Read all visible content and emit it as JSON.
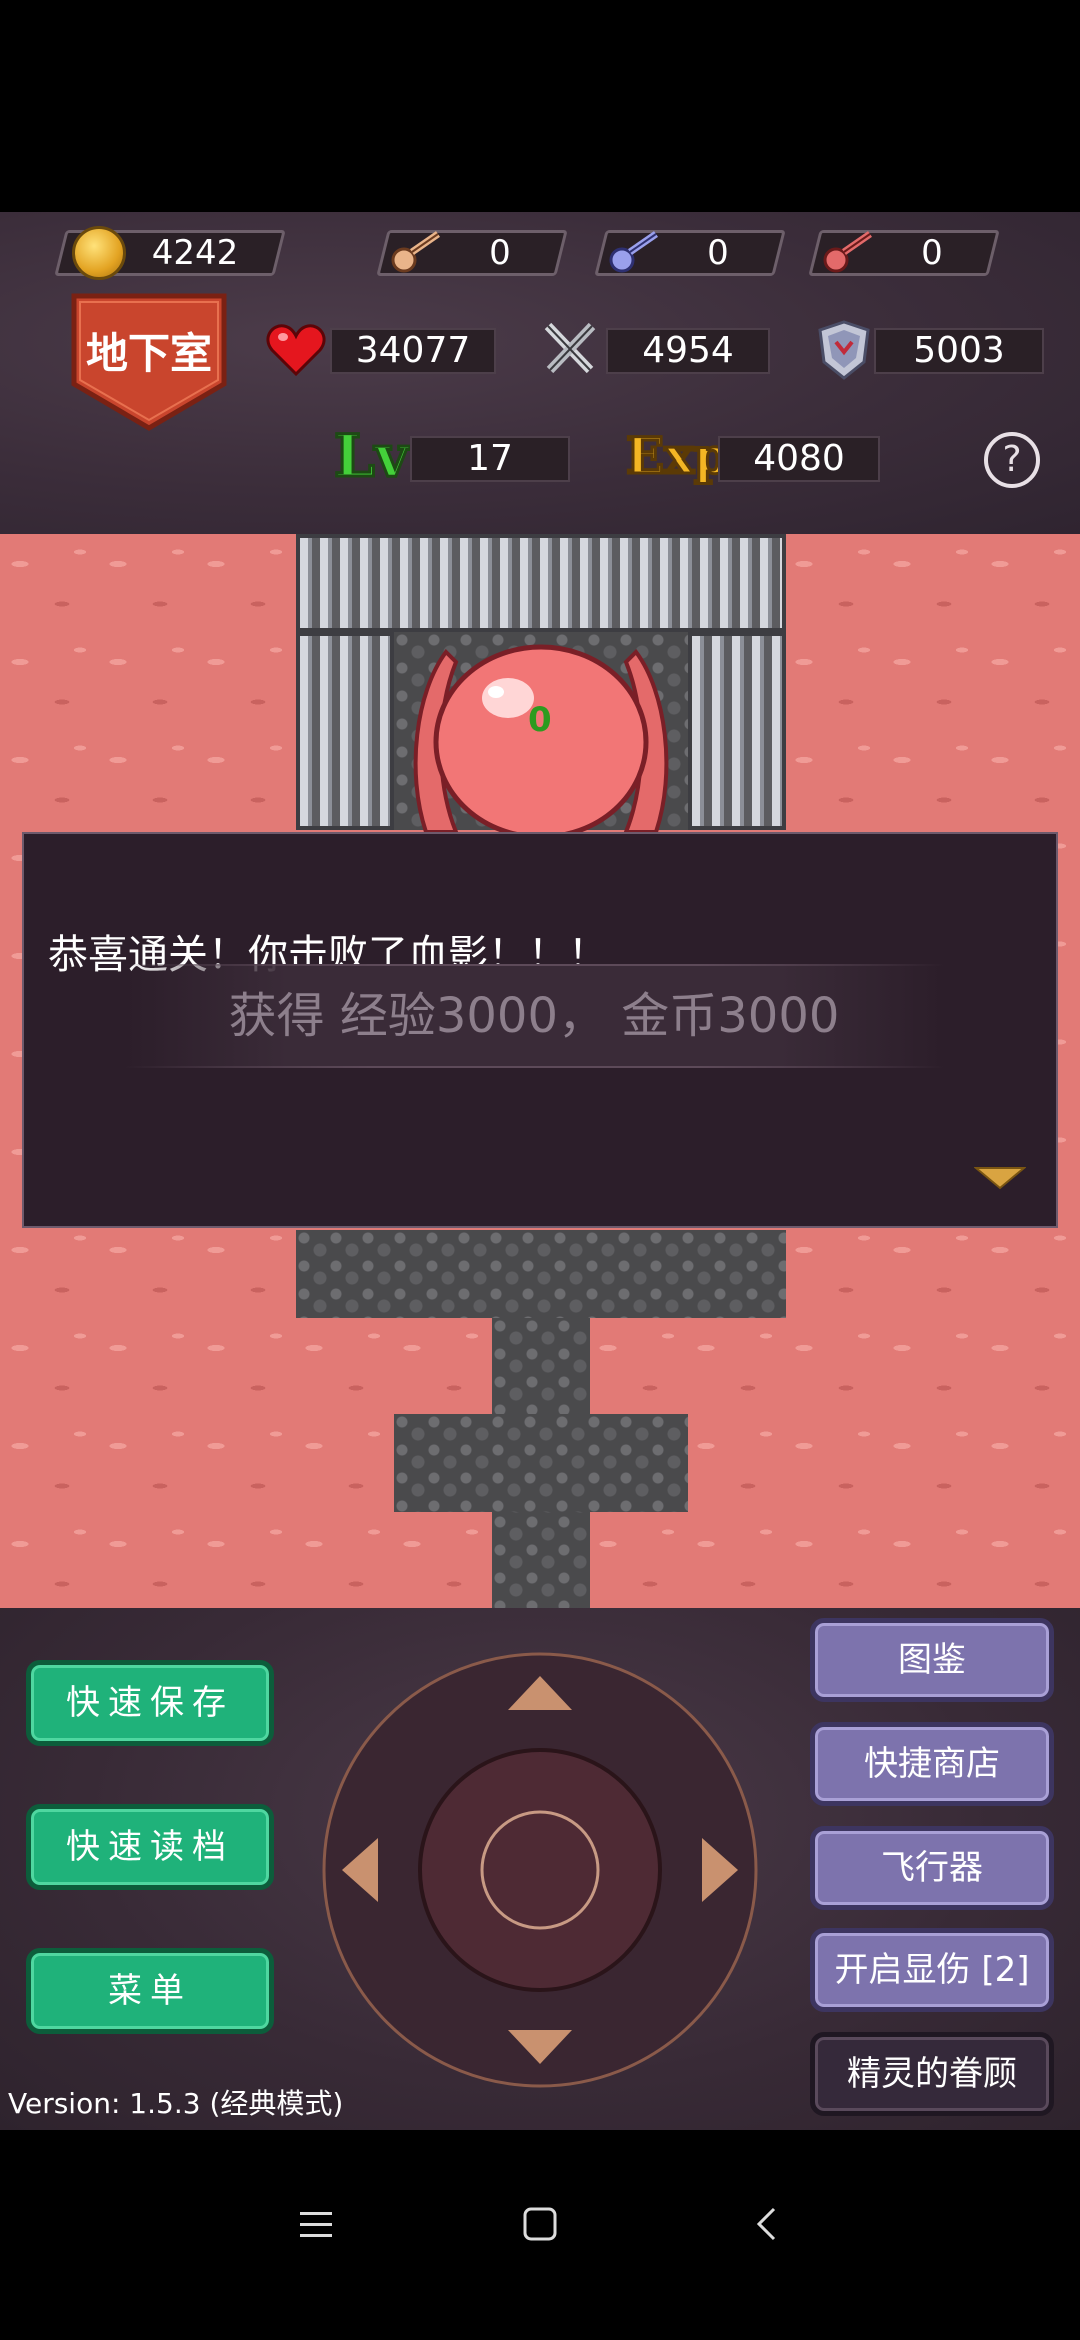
{
  "resources": {
    "gold": "4242",
    "yellow_keys": "0",
    "blue_keys": "0",
    "red_keys": "0"
  },
  "floor": {
    "name": "地下室"
  },
  "stats": {
    "hp": "34077",
    "attack": "4954",
    "defense": "5003",
    "level_label": "Lv",
    "level": "17",
    "exp_label": "Exp",
    "exp": "4080",
    "help": "?"
  },
  "map": {
    "boss_damage": "0"
  },
  "dialog": {
    "message": "恭喜通关！你击败了血影！！！",
    "reward": "获得 经验3000， 金币3000"
  },
  "controls": {
    "quick_save": "快速保存",
    "quick_load": "快速读档",
    "menu": "菜单",
    "monster_book": "图鉴",
    "quick_shop": "快捷商店",
    "fly": "飞行器",
    "show_damage": "开启显伤 [2]",
    "fairy_favor": "精灵的眷顾",
    "version": "Version: 1.5.3 (经典模式)"
  },
  "colors": {
    "hud_bg": "#3b2d3a",
    "lava": "#e27a76",
    "green_button": "#1fb27a",
    "purple_button": "#7d73ad",
    "lv_green": "#44d03a",
    "exp_gold": "#f3b624"
  },
  "icons": [
    "coin-icon",
    "yellow-key-icon",
    "blue-key-icon",
    "red-key-icon",
    "heart-icon",
    "sword-icon",
    "shield-icon",
    "help-icon",
    "dpad-up-icon",
    "dpad-down-icon",
    "dpad-left-icon",
    "dpad-right-icon",
    "continue-arrow-icon",
    "nav-menu-icon",
    "nav-home-icon",
    "nav-back-icon"
  ]
}
